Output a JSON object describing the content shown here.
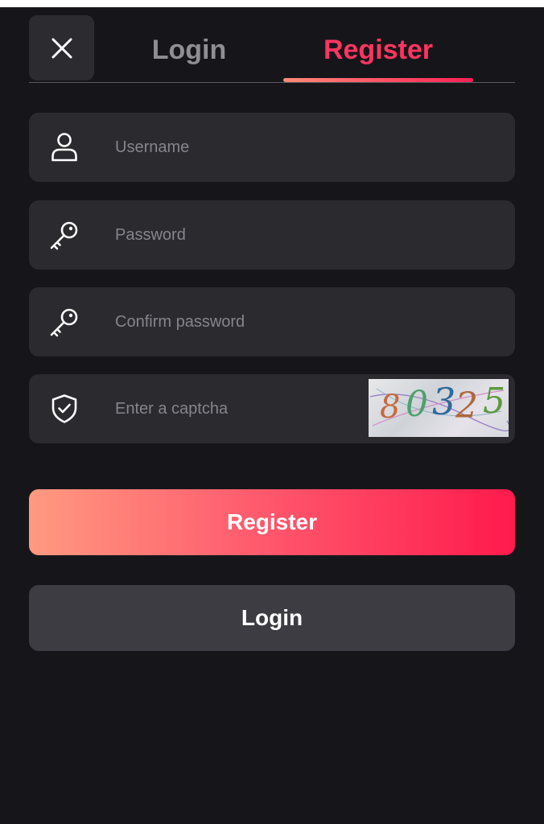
{
  "tabs": {
    "login_label": "Login",
    "register_label": "Register",
    "active": "register"
  },
  "form": {
    "username_placeholder": "Username",
    "password_placeholder": "Password",
    "confirm_password_placeholder": "Confirm password",
    "captcha_placeholder": "Enter a captcha",
    "captcha_code": "80325"
  },
  "buttons": {
    "register_label": "Register",
    "login_label": "Login"
  },
  "icons": {
    "close": "close-icon",
    "username": "user-icon",
    "password": "key-icon",
    "confirm_password": "key-icon",
    "captcha": "shield-check-icon"
  },
  "colors": {
    "background": "#16161a",
    "field_background": "#2a2a2f",
    "accent": "#ff3560",
    "register_gradient_start": "#ff9a80",
    "register_gradient_end": "#ff1a4d",
    "login_button": "#3c3c42",
    "inactive_tab": "#8e8e93",
    "placeholder": "#85858b"
  }
}
